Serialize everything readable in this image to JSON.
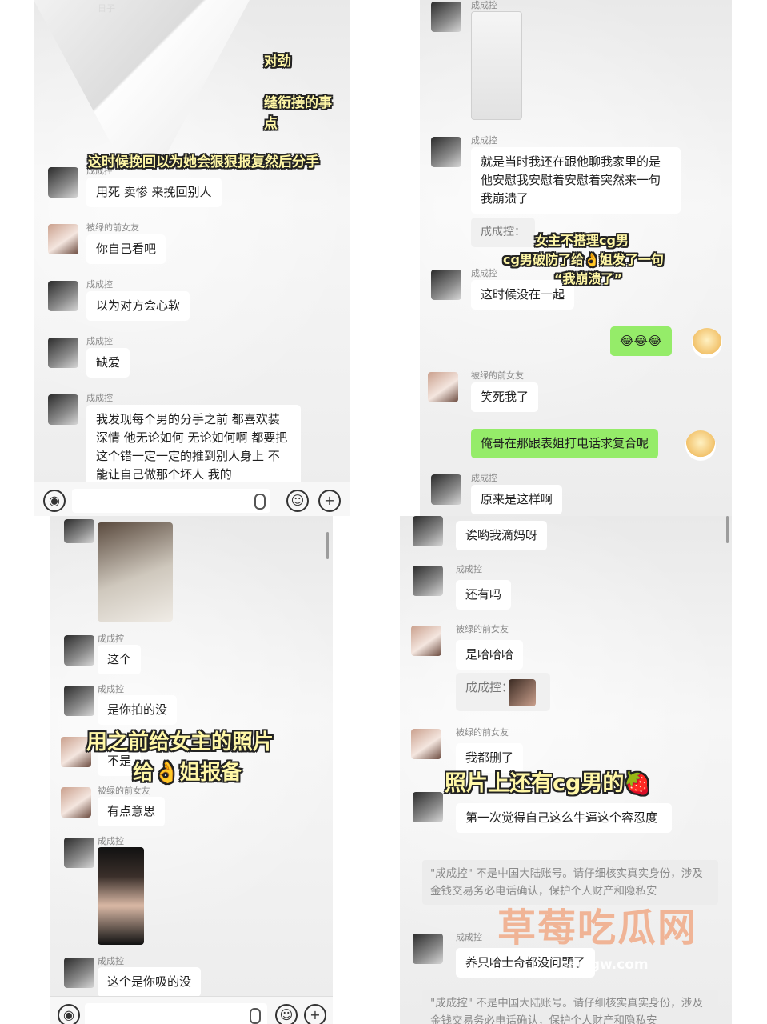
{
  "panel_tl": {
    "top_fragment": "日子",
    "captions": [
      "对劲",
      "缝衔接的事",
      "点",
      "这时候挽回以为她会狠狠报复然后分手"
    ],
    "messages": [
      {
        "name": "成成控",
        "text": "用死 卖惨 来挽回别人"
      },
      {
        "name": "被绿的前女友",
        "text": "你自己看吧"
      },
      {
        "name": "成成控",
        "text": "以为对方会心软"
      },
      {
        "name": "成成控",
        "text": "缺爱"
      },
      {
        "name": "成成控",
        "text": "我发现每个男的分手之前 都喜欢装深情 他无论如何 无论如何啊 都要把这个错一定一定的推到别人身上 不能让自己做那个坏人 我的"
      }
    ]
  },
  "panel_tr": {
    "messages": [
      {
        "name": "成成控",
        "text": ""
      },
      {
        "name": "成成控",
        "text": "就是当时我还在跟他聊我家里的是 他安慰我安慰着安慰着突然来一句 我崩溃了"
      },
      {
        "name": "",
        "text": "成成控："
      },
      {
        "name": "成成控",
        "text": "这时候没在一起"
      },
      {
        "name": "",
        "text": "😂😂😂"
      },
      {
        "name": "被绿的前女友",
        "text": "笑死我了"
      },
      {
        "name": "",
        "text": "俺哥在那跟表姐打电话求复合呢"
      },
      {
        "name": "成成控",
        "text": "原来是这样啊"
      }
    ],
    "caption_lines": [
      "女主不搭理cg男",
      "cg男破防了给👌姐发了一句",
      "“我崩溃了”"
    ]
  },
  "panel_bl": {
    "messages": [
      {
        "name": "成成控",
        "text": "这个"
      },
      {
        "name": "成成控",
        "text": "是你拍的没"
      },
      {
        "name": "",
        "text": "不是"
      },
      {
        "name": "被绿的前女友",
        "text": "有点意思"
      },
      {
        "name": "成成控",
        "text": ""
      },
      {
        "name": "成成控",
        "text": "这个是你吸的没"
      }
    ],
    "caption_lines": [
      "用之前给女主的照片",
      "给👌姐报备"
    ]
  },
  "panel_br": {
    "messages": [
      {
        "name": "",
        "text": "诶哟我滴妈呀"
      },
      {
        "name": "成成控",
        "text": "还有吗"
      },
      {
        "name": "被绿的前女友",
        "text": "是哈哈哈"
      },
      {
        "name": "",
        "text": "成成控："
      },
      {
        "name": "被绿的前女友",
        "text": "我都删了"
      },
      {
        "name": "",
        "text": "第一次觉得自己这么牛逼这个容忍度"
      },
      {
        "name": "成成控",
        "text": "养只哈士奇都没问题了"
      }
    ],
    "caption": "照片上还有cg男的🍓",
    "notice": "\"成成控\" 不是中国大陆账号。请仔细核实真实身份，涉及金钱交易务必电话确认，保护个人财产和隐私安",
    "notice2": "\"成成控\" 不是中国大陆账号。请仔细核实真实身份，涉及金钱交易务必电话确认，保护个人财产和隐私安"
  },
  "watermark": {
    "text": "草莓吃瓜网",
    "url": "cmcgw.com"
  },
  "icons": [
    "voice-icon",
    "microphone-icon",
    "emoji-icon",
    "plus-icon"
  ]
}
